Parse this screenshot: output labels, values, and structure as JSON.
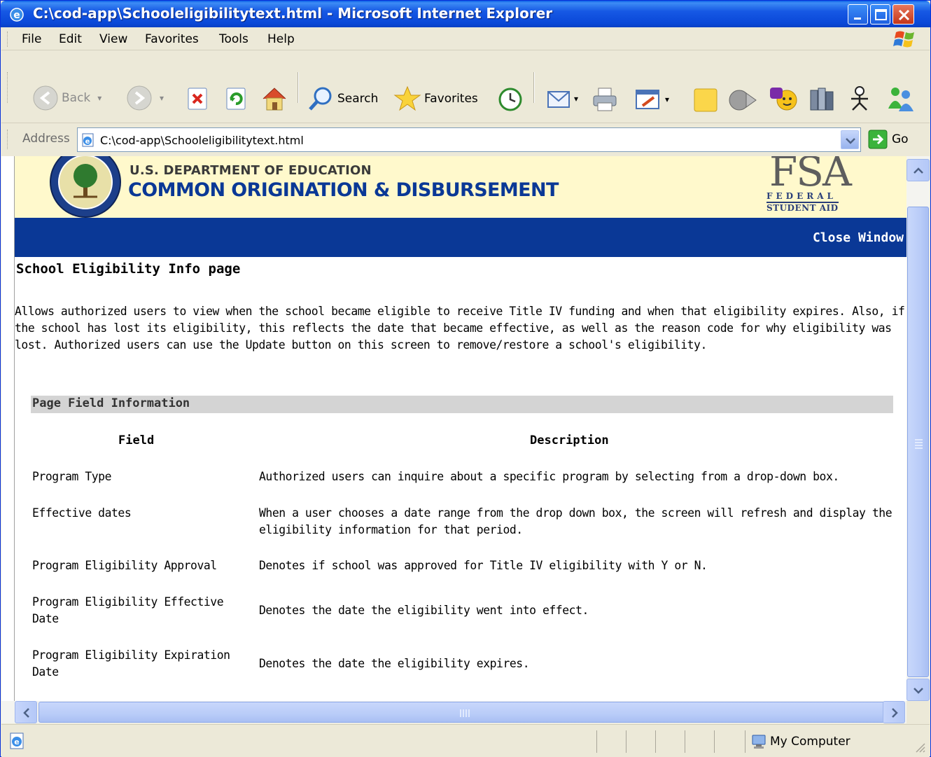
{
  "window": {
    "title": "C:\\cod-app\\Schooleligibilitytext.html - Microsoft Internet Explorer"
  },
  "menu": [
    "File",
    "Edit",
    "View",
    "Favorites",
    "Tools",
    "Help"
  ],
  "toolbar": {
    "back_label": "Back",
    "search_label": "Search",
    "favorites_label": "Favorites"
  },
  "address": {
    "label": "Address",
    "url": "C:\\cod-app\\Schooleligibilitytext.html",
    "go_label": "Go"
  },
  "banner": {
    "department": "U.S. DEPARTMENT OF EDUCATION",
    "system": "COMMON ORIGINATION & DISBURSEMENT",
    "fsa_big": "FSA",
    "fsa_line1": "FEDERAL",
    "fsa_line2": "STUDENT AID"
  },
  "close_window_label": "Close Window",
  "page": {
    "heading": "School Eligibility Info page",
    "intro": "Allows authorized users to view when the school became eligible to receive Title IV funding and when that eligibility expires. Also, if the school has lost its eligibility, this reflects the date that became effective, as well as the reason code for why eligibility was lost. Authorized users can use the Update button on this screen to remove/restore a school's eligibility.",
    "section_title": "Page Field Information",
    "col_field": "Field",
    "col_description": "Description",
    "rows": [
      {
        "field": "Program Type",
        "description": "Authorized users can inquire about a specific program by selecting from a drop-down box."
      },
      {
        "field": "Effective dates",
        "description": "When a user chooses a date range from the drop down box, the screen will refresh and display the eligibility information for that period."
      },
      {
        "field": "Program Eligibility Approval",
        "description": "Denotes if school was approved for Title IV eligibility with Y or N."
      },
      {
        "field": "Program Eligibility Effective Date",
        "description": "Denotes the date the eligibility went into effect."
      },
      {
        "field": "Program Eligibility Expiration Date",
        "description": "Denotes the date the eligibility expires."
      }
    ]
  },
  "status": {
    "zone": "My Computer"
  }
}
